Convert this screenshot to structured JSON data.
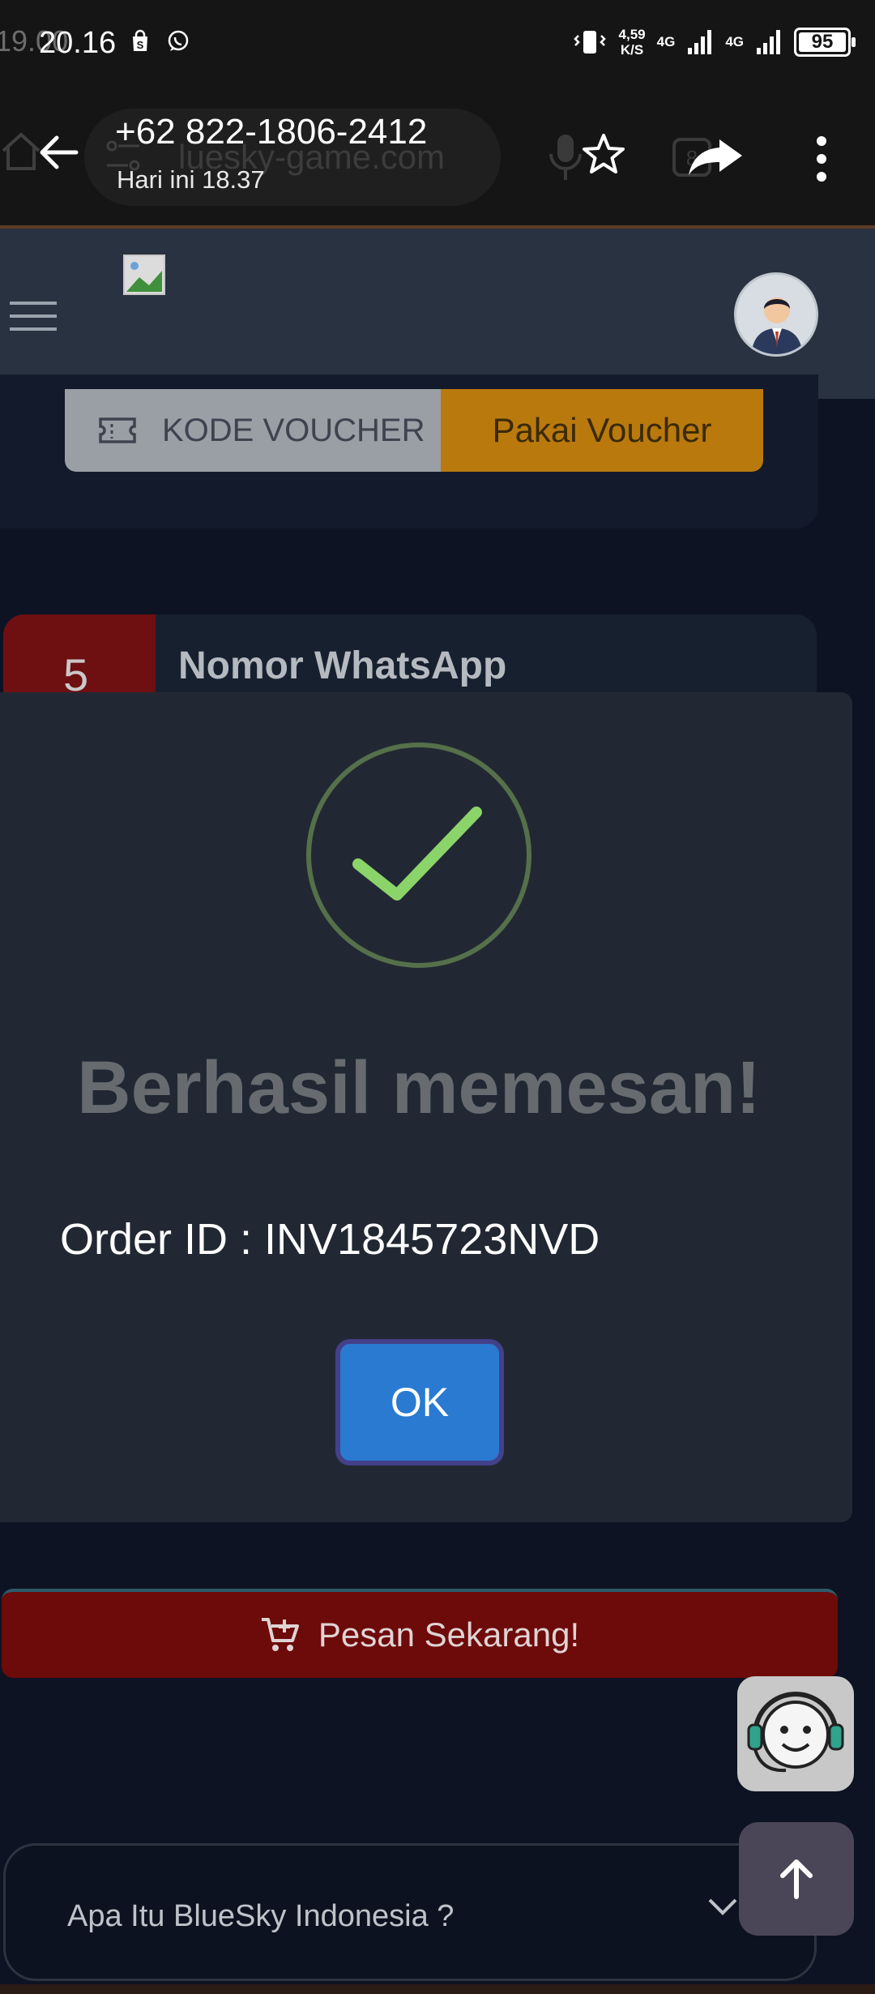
{
  "status_bar": {
    "time": "20.16",
    "ghost_time": "19.00",
    "net_speed_value": "4,59",
    "net_speed_unit": "K/S",
    "network_1": "4G",
    "network_2": "4G",
    "battery": "95"
  },
  "header": {
    "contact": "+62 822-1806-2412",
    "subtitle": "Hari ini 18.37",
    "url_ghost": "luesky-game.com"
  },
  "voucher": {
    "placeholder": "KODE VOUCHER",
    "button": "Pakai Voucher"
  },
  "step": {
    "number": "5",
    "title": "Nomor WhatsApp"
  },
  "dialog": {
    "title": "Berhasil memesan!",
    "order_id": "Order ID : INV1845723NVD",
    "ok": "OK"
  },
  "order_button": "Pesan Sekarang!",
  "faq": {
    "question": "Apa Itu BlueSky Indonesia ?"
  },
  "colors": {
    "success_check": "#8bd46a",
    "ok_button": "#2a7ad2",
    "order_button": "#6d0a0a",
    "voucher_button": "#b9790d"
  }
}
